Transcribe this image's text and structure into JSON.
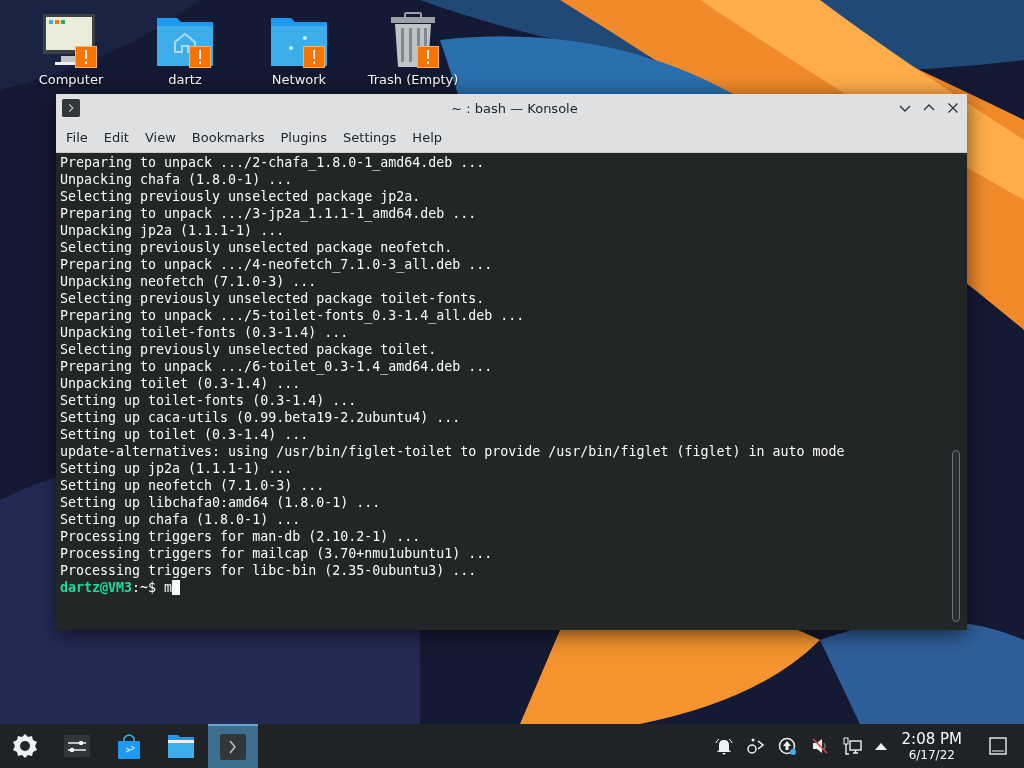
{
  "desktop_icons": [
    {
      "label": "Computer",
      "kind": "computer",
      "warning": true
    },
    {
      "label": "dartz",
      "kind": "home",
      "warning": true
    },
    {
      "label": "Network",
      "kind": "network",
      "warning": true
    },
    {
      "label": "Trash (Empty)",
      "kind": "trash",
      "warning": true
    }
  ],
  "window": {
    "title": "~ : bash — Konsole",
    "menu": [
      "File",
      "Edit",
      "View",
      "Bookmarks",
      "Plugins",
      "Settings",
      "Help"
    ]
  },
  "terminal": {
    "lines": [
      "Preparing to unpack .../2-chafa_1.8.0-1_amd64.deb ...",
      "Unpacking chafa (1.8.0-1) ...",
      "Selecting previously unselected package jp2a.",
      "Preparing to unpack .../3-jp2a_1.1.1-1_amd64.deb ...",
      "Unpacking jp2a (1.1.1-1) ...",
      "Selecting previously unselected package neofetch.",
      "Preparing to unpack .../4-neofetch_7.1.0-3_all.deb ...",
      "Unpacking neofetch (7.1.0-3) ...",
      "Selecting previously unselected package toilet-fonts.",
      "Preparing to unpack .../5-toilet-fonts_0.3-1.4_all.deb ...",
      "Unpacking toilet-fonts (0.3-1.4) ...",
      "Selecting previously unselected package toilet.",
      "Preparing to unpack .../6-toilet_0.3-1.4_amd64.deb ...",
      "Unpacking toilet (0.3-1.4) ...",
      "Setting up toilet-fonts (0.3-1.4) ...",
      "Setting up caca-utils (0.99.beta19-2.2ubuntu4) ...",
      "Setting up toilet (0.3-1.4) ...",
      "update-alternatives: using /usr/bin/figlet-toilet to provide /usr/bin/figlet (figlet) in auto mode",
      "Setting up jp2a (1.1.1-1) ...",
      "Setting up neofetch (7.1.0-3) ...",
      "Setting up libchafa0:amd64 (1.8.0-1) ...",
      "Setting up chafa (1.8.0-1) ...",
      "Processing triggers for man-db (2.10.2-1) ...",
      "Processing triggers for mailcap (3.70+nmu1ubuntu1) ...",
      "Processing triggers for libc-bin (2.35-0ubuntu3) ..."
    ],
    "prompt": {
      "user": "dartz@VM3",
      "rest": ":~$",
      "input": "m"
    }
  },
  "taskbar": {
    "apps": [
      {
        "kind": "launcher",
        "selected": false
      },
      {
        "kind": "settings",
        "selected": false
      },
      {
        "kind": "store",
        "selected": false
      },
      {
        "kind": "files",
        "selected": false
      },
      {
        "kind": "terminal",
        "selected": true
      }
    ],
    "tray": [
      {
        "kind": "bell"
      },
      {
        "kind": "share"
      },
      {
        "kind": "update"
      },
      {
        "kind": "mute"
      },
      {
        "kind": "network"
      },
      {
        "kind": "expand"
      }
    ],
    "clock": {
      "time": "2:08 PM",
      "date": "6/17/22"
    }
  }
}
